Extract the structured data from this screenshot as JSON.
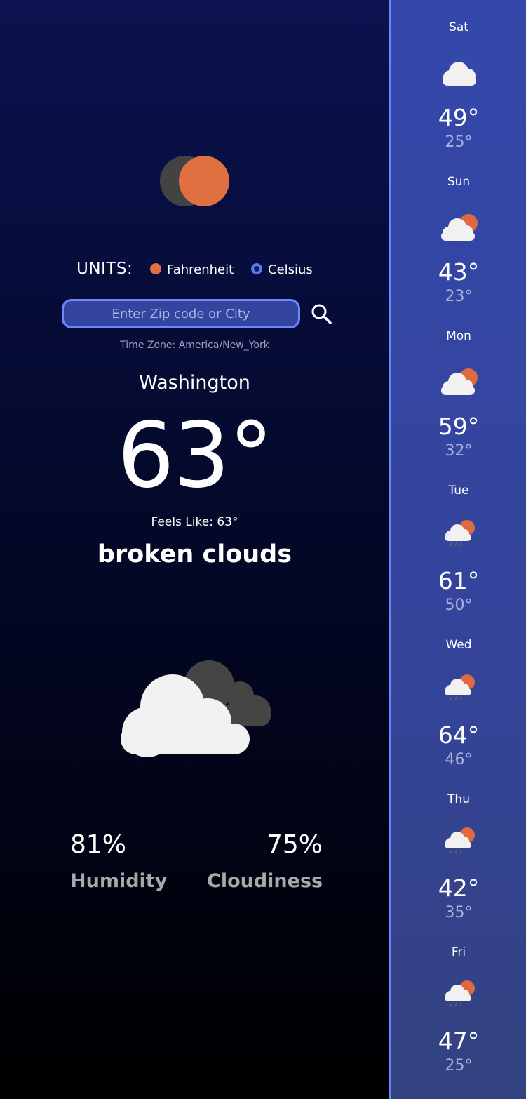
{
  "units": {
    "label": "UNITS:",
    "options": [
      {
        "label": "Fahrenheit",
        "selected": true
      },
      {
        "label": "Celsius",
        "selected": false
      }
    ]
  },
  "search": {
    "placeholder": "Enter Zip code or City"
  },
  "current": {
    "timezone": "Time Zone: America/New_York",
    "city": "Washington",
    "temperature": "63°",
    "feels_like": "Feels Like: 63°",
    "description": "broken clouds",
    "icon": "broken-clouds-icon"
  },
  "stats": {
    "humidity_value": "81%",
    "humidity_label": "Humidity",
    "cloudiness_value": "75%",
    "cloudiness_label": "Cloudiness"
  },
  "forecast": [
    {
      "day": "Sat",
      "icon": "cloud-icon",
      "high": "49°",
      "low": "25°"
    },
    {
      "day": "Sun",
      "icon": "partly-cloudy-icon",
      "high": "43°",
      "low": "23°"
    },
    {
      "day": "Mon",
      "icon": "partly-cloudy-icon",
      "high": "59°",
      "low": "32°"
    },
    {
      "day": "Tue",
      "icon": "rain-partly-cloudy-icon",
      "high": "61°",
      "low": "50°"
    },
    {
      "day": "Wed",
      "icon": "rain-partly-cloudy-icon",
      "high": "64°",
      "low": "46°"
    },
    {
      "day": "Thu",
      "icon": "rain-partly-cloudy-icon",
      "high": "42°",
      "low": "35°"
    },
    {
      "day": "Fri",
      "icon": "rain-partly-cloudy-icon",
      "high": "47°",
      "low": "25°"
    }
  ],
  "colors": {
    "accent_orange": "#e07040",
    "accent_blue": "#6b84ff",
    "forecast_bg": "#3448ab"
  }
}
